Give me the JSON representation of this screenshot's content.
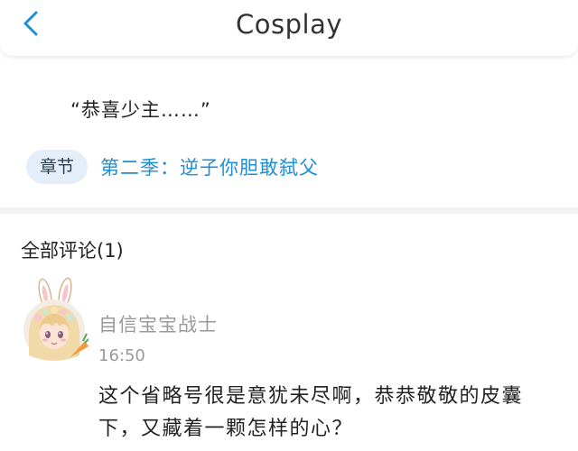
{
  "header": {
    "title": "Cosplay",
    "back_icon": "chevron-left-icon",
    "accent_color": "#1e8fd6"
  },
  "excerpt": {
    "text": "“恭喜少主……”"
  },
  "chapter": {
    "badge_label": "章节",
    "link_text": "第二季：逆子你胆敢弑父"
  },
  "comments": {
    "header": "全部评论(1)",
    "items": [
      {
        "avatar": "anime-girl-bunny-ears-avatar",
        "username": "自信宝宝战士",
        "time": "16:50",
        "text": "这个省略号很是意犹未尽啊，恭恭敬敬的皮囊下，又藏着一颗怎样的心？"
      }
    ]
  }
}
